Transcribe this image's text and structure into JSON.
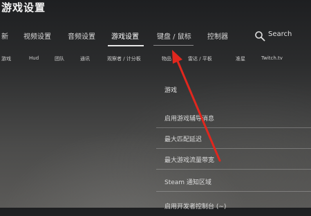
{
  "page": {
    "title": "游戏设置"
  },
  "top_tabs": [
    {
      "label": "新"
    },
    {
      "label": "视频设置"
    },
    {
      "label": "音频设置"
    },
    {
      "label": "游戏设置"
    },
    {
      "label": "键盘 / 鼠标"
    },
    {
      "label": "控制器"
    }
  ],
  "search": {
    "label": "Search"
  },
  "sub_tabs": [
    {
      "label": "游戏"
    },
    {
      "label": "Hud"
    },
    {
      "label": "团队"
    },
    {
      "label": "通讯"
    },
    {
      "label": "观察者 / 计分板"
    },
    {
      "label": "物品"
    },
    {
      "label": "雷达 / 平板"
    },
    {
      "label": "准星"
    },
    {
      "label": "Twitch.tv"
    }
  ],
  "section": {
    "title": "游戏"
  },
  "options": [
    {
      "label": "启用游戏辅导消息"
    },
    {
      "label": "最大匹配延迟"
    },
    {
      "label": "最大游戏流量带宽"
    },
    {
      "label": "Steam 通知区域"
    },
    {
      "label": "启用开发者控制台 (~)"
    }
  ],
  "colors": {
    "annotation_arrow": "#e0271e"
  }
}
